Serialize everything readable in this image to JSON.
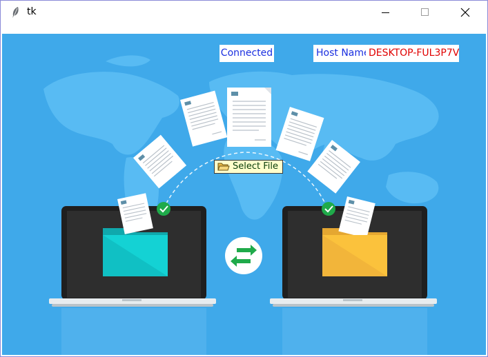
{
  "window": {
    "title": "tk"
  },
  "status": {
    "connected_text": "Connected"
  },
  "host": {
    "label": "Host Name",
    "value": "DESKTOP-FUL3P7V"
  },
  "actions": {
    "select_file_label": "Select File"
  },
  "colors": {
    "background": "#3fa9ea",
    "label_blue": "#1a2fe0",
    "host_value_red": "#e00000",
    "select_button_bg": "#ffffcc",
    "check_green": "#1faa4a"
  },
  "icons": [
    "feather-icon",
    "minimize-icon",
    "maximize-icon",
    "close-icon",
    "folder-icon",
    "check-icon",
    "transfer-arrows-icon"
  ]
}
